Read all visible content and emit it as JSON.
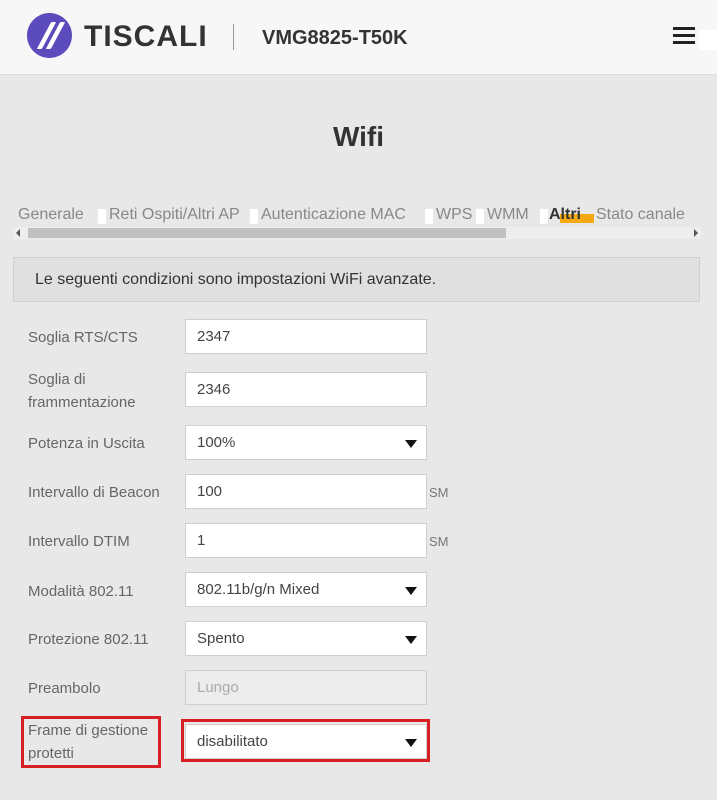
{
  "header": {
    "brand": "TISCALI",
    "model": "VMG8825-T50K"
  },
  "page_title": "Wifi",
  "tabs": [
    {
      "label": "Generale",
      "active": false
    },
    {
      "label": "Reti Ospiti/Altri AP",
      "active": false
    },
    {
      "label": "Autenticazione MAC",
      "active": false
    },
    {
      "label": "WPS",
      "active": false
    },
    {
      "label": "WMM",
      "active": false
    },
    {
      "label": "Altri",
      "active": true
    },
    {
      "label": "Stato canale",
      "active": false
    }
  ],
  "info_text": "Le seguenti condizioni sono impostazioni WiFi avanzate.",
  "form": {
    "rts_cts": {
      "label": "Soglia RTS/CTS",
      "value": "2347"
    },
    "fragmentation": {
      "label_line1": "Soglia di",
      "label_line2": "frammentazione",
      "value": "2346"
    },
    "output_power": {
      "label": "Potenza in Uscita",
      "value": "100%"
    },
    "beacon_interval": {
      "label": "Intervallo di Beacon",
      "value": "100",
      "unit": "SM"
    },
    "dtim_interval": {
      "label": "Intervallo DTIM",
      "value": "1",
      "unit": "SM"
    },
    "mode_80211": {
      "label": "Modalità 802.11",
      "value": "802.11b/g/n Mixed"
    },
    "protection_80211": {
      "label": "Protezione 802.11",
      "value": "Spento"
    },
    "preamble": {
      "label": "Preambolo",
      "value": "Lungo"
    },
    "pmf": {
      "label_line1": "Frame di gestione",
      "label_line2": "protetti",
      "value": "disabilitato"
    }
  },
  "colors": {
    "accent": "#f3a814",
    "logo": "#5b4bbd",
    "highlight": "#d81f26"
  }
}
